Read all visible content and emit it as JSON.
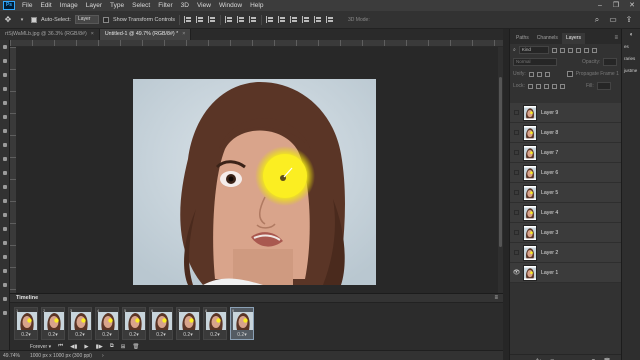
{
  "menubar": {
    "logo": "Ps",
    "items": [
      "File",
      "Edit",
      "Image",
      "Layer",
      "Type",
      "Select",
      "Filter",
      "3D",
      "View",
      "Window",
      "Help"
    ]
  },
  "options": {
    "auto_select_label": "Auto-Select:",
    "auto_select_target": "Layer",
    "transform_label": "Show Transform Controls",
    "mode_3d_label": "3D Mode:"
  },
  "tabs": [
    {
      "label": "rtSjWaMLb.jpg @ 36.3% (RGB/8#)",
      "active": false
    },
    {
      "label": "Untitled-1 @ 49.7% (RGB/8#) *",
      "active": true
    }
  ],
  "timeline": {
    "title": "Timeline",
    "loop": "Forever",
    "frames": [
      {
        "num": "1",
        "delay": "0.2"
      },
      {
        "num": "2",
        "delay": "0.2"
      },
      {
        "num": "3",
        "delay": "0.2"
      },
      {
        "num": "4",
        "delay": "0.2"
      },
      {
        "num": "5",
        "delay": "0.2"
      },
      {
        "num": "6",
        "delay": "0.2"
      },
      {
        "num": "7",
        "delay": "0.2"
      },
      {
        "num": "8",
        "delay": "0.2"
      },
      {
        "num": "9",
        "delay": "0.2"
      }
    ]
  },
  "status": {
    "zoom": "49.74%",
    "doc_info": "1000 px x 1000 px (300 ppi)"
  },
  "layers_panel": {
    "tabs": [
      "Paths",
      "Channels",
      "Layers"
    ],
    "active_tab": "Layers",
    "kind_label": "Kind",
    "blend_mode": "Normal",
    "opacity_label": "Opacity:",
    "unify_label": "Unify:",
    "propagate_label": "Propagate Frame 1",
    "lock_label": "Lock:",
    "fill_label": "Fill:",
    "layers": [
      {
        "name": "Layer 9",
        "visible": false
      },
      {
        "name": "Layer 8",
        "visible": false
      },
      {
        "name": "Layer 7",
        "visible": false
      },
      {
        "name": "Layer 6",
        "visible": false
      },
      {
        "name": "Layer 5",
        "visible": false
      },
      {
        "name": "Layer 4",
        "visible": false
      },
      {
        "name": "Layer 3",
        "visible": false
      },
      {
        "name": "Layer 2",
        "visible": false
      },
      {
        "name": "Layer 1",
        "visible": true
      }
    ]
  },
  "collapsed_panels": {
    "items": [
      "es",
      "raries",
      "justme"
    ]
  }
}
